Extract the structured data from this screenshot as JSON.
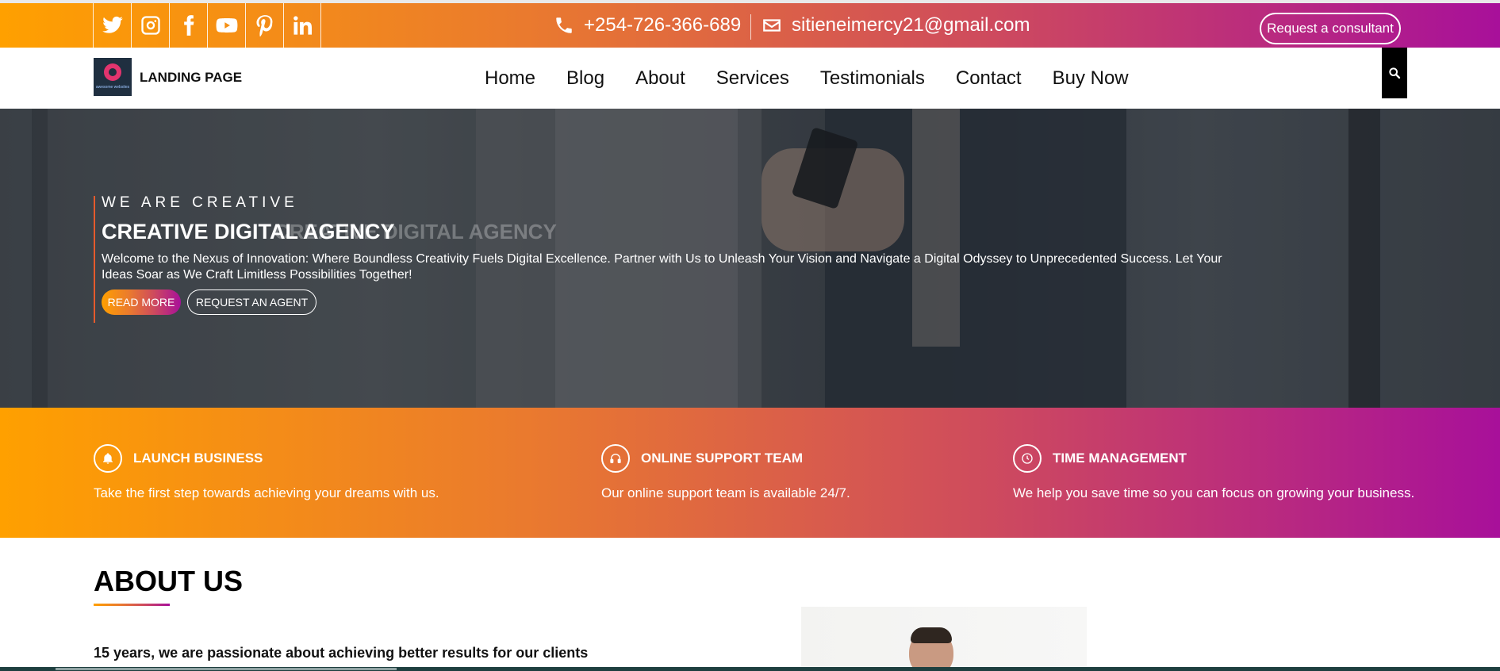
{
  "topbar": {
    "social_icons": [
      "twitter-icon",
      "instagram-icon",
      "facebook-icon",
      "youtube-icon",
      "pinterest-icon",
      "linkedin-icon"
    ],
    "phone": "+254-726-366-689",
    "email": "sitieneimercy21@gmail.com",
    "consult_label": "Request a consultant"
  },
  "navbar": {
    "logo_text": "awesome websites",
    "brand": "LANDING PAGE",
    "menu": [
      "Home",
      "Blog",
      "About",
      "Services",
      "Testimonials",
      "Contact",
      "Buy Now"
    ],
    "search_icon": "search-icon"
  },
  "hero": {
    "eyebrow": "WE ARE CREATIVE",
    "title": "CREATIVE DIGITAL AGENCY",
    "ghost_title": "CREATIVE DIGITAL AGENCY",
    "description": "Welcome to the Nexus of Innovation: Where Boundless Creativity Fuels Digital Excellence. Partner with Us to Unleash Your Vision and Navigate a Digital Odyssey to Unprecedented Success. Let Your Ideas Soar as We Craft Limitless Possibilities Together!",
    "read_more": "READ MORE",
    "request_agent": "REQUEST AN AGENT"
  },
  "features": [
    {
      "icon": "bell-icon",
      "title": "LAUNCH BUSINESS",
      "text": "Take the first step towards achieving your dreams with us."
    },
    {
      "icon": "headphones-icon",
      "title": "ONLINE SUPPORT TEAM",
      "text": "Our online support team is available 24/7."
    },
    {
      "icon": "clock-icon",
      "title": "TIME MANAGEMENT",
      "text": "We help you save time so you can focus on growing your business."
    }
  ],
  "about": {
    "title": "ABOUT US",
    "subtitle": "15 years, we are passionate about achieving better results for our clients"
  },
  "colors": {
    "gradient_start": "#ffa000",
    "gradient_mid": "#cf4c5c",
    "gradient_end": "#a8109a",
    "dark": "#000000"
  }
}
